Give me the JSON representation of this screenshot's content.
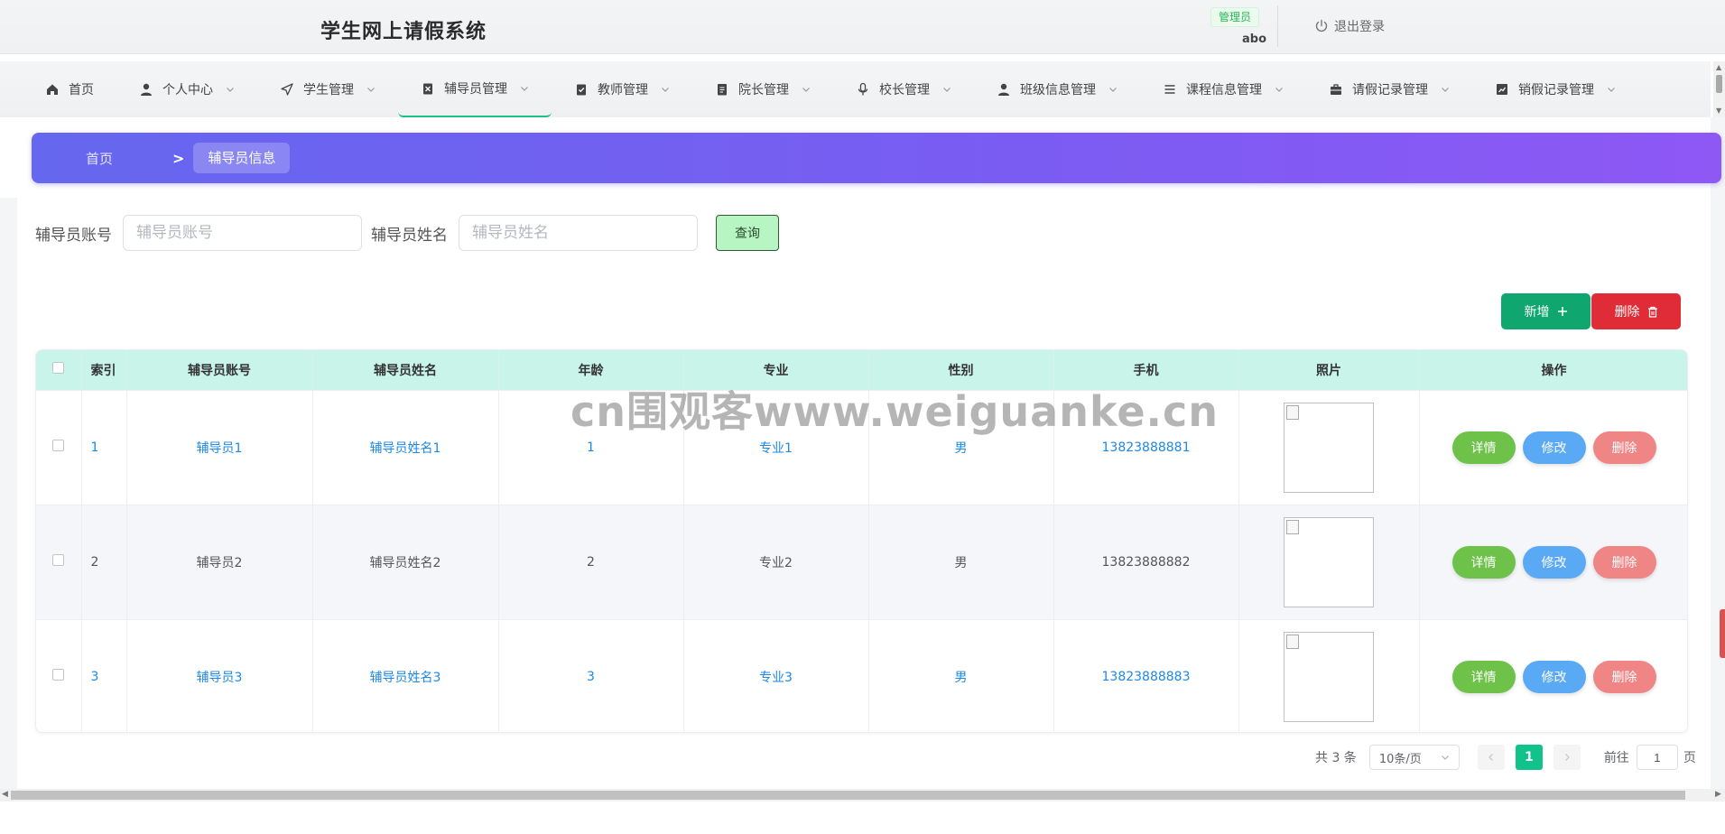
{
  "header": {
    "title": "学生网上请假系统",
    "role_badge": "管理员",
    "username": "abo",
    "logout_label": "退出登录"
  },
  "nav": {
    "items": [
      {
        "label": "首页",
        "icon": "home-icon"
      },
      {
        "label": "个人中心",
        "icon": "user-icon"
      },
      {
        "label": "学生管理",
        "icon": "send-icon"
      },
      {
        "label": "辅导员管理",
        "icon": "clipboard-icon"
      },
      {
        "label": "教师管理",
        "icon": "checklist-icon"
      },
      {
        "label": "院长管理",
        "icon": "document-icon"
      },
      {
        "label": "校长管理",
        "icon": "microphone-icon"
      },
      {
        "label": "班级信息管理",
        "icon": "user-icon"
      },
      {
        "label": "课程信息管理",
        "icon": "list-icon"
      },
      {
        "label": "请假记录管理",
        "icon": "briefcase-icon"
      },
      {
        "label": "销假记录管理",
        "icon": "chart-icon"
      }
    ],
    "active": "辅导员管理"
  },
  "breadcrumb": {
    "home": "首页",
    "separator": ">",
    "current": "辅导员信息"
  },
  "search": {
    "account_label": "辅导员账号",
    "account_placeholder": "辅导员账号",
    "name_label": "辅导员姓名",
    "name_placeholder": "辅导员姓名",
    "query_button": "查询"
  },
  "actions": {
    "add_label": "新增",
    "delete_label": "删除"
  },
  "table": {
    "columns": [
      "索引",
      "辅导员账号",
      "辅导员姓名",
      "年龄",
      "专业",
      "性别",
      "手机",
      "照片",
      "操作"
    ],
    "rows": [
      {
        "index": "1",
        "account": "辅导员1",
        "name": "辅导员姓名1",
        "age": "1",
        "major": "专业1",
        "gender": "男",
        "phone": "13823888881"
      },
      {
        "index": "2",
        "account": "辅导员2",
        "name": "辅导员姓名2",
        "age": "2",
        "major": "专业2",
        "gender": "男",
        "phone": "13823888882"
      },
      {
        "index": "3",
        "account": "辅导员3",
        "name": "辅导员姓名3",
        "age": "3",
        "major": "专业3",
        "gender": "男",
        "phone": "13823888883"
      }
    ],
    "row_actions": {
      "detail": "详情",
      "edit": "修改",
      "remove": "删除"
    }
  },
  "watermark": "cn围观客www.weiguanke.cn",
  "pagination": {
    "total": "共 3 条",
    "page_size": "10条/页",
    "current_page": "1",
    "goto_label": "前往",
    "goto_value": "1",
    "goto_unit": "页"
  },
  "colors": {
    "accent": "#11c28a",
    "banner_start": "#6567ef",
    "banner_end": "#8e58f5",
    "table_header": "#c9f4ea",
    "add_button": "#10a66f",
    "delete_button": "#e02c36"
  }
}
